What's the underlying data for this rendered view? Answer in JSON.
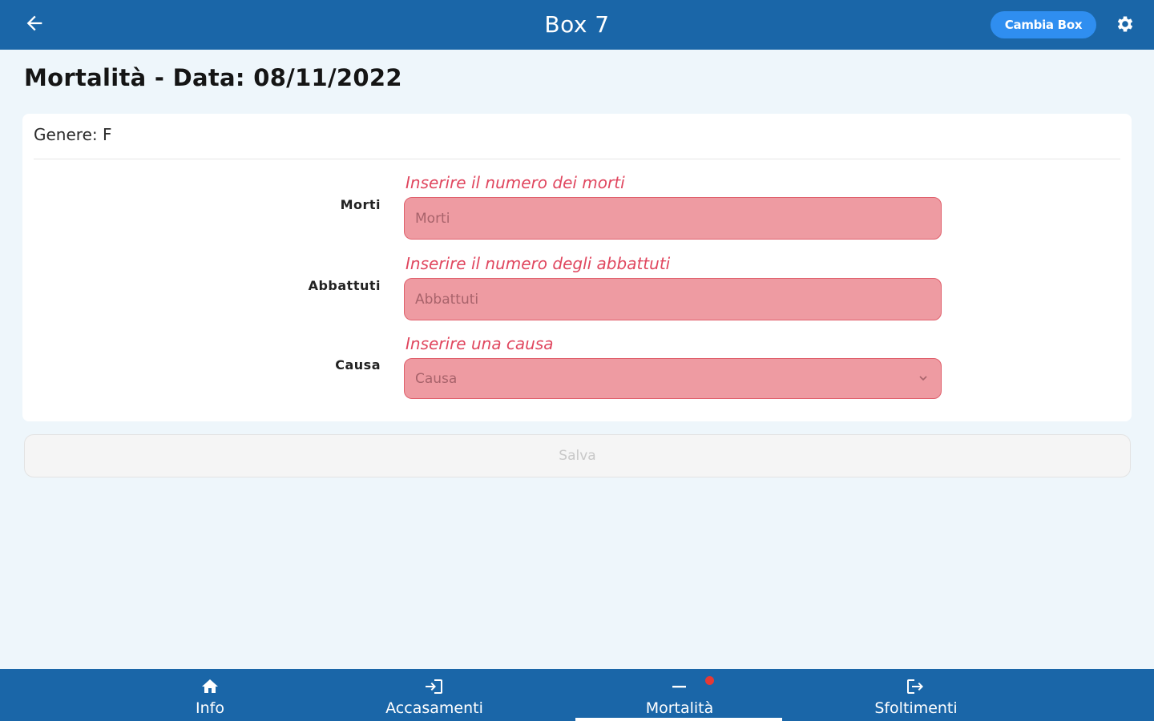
{
  "topbar": {
    "title": "Box 7",
    "cambia_label": "Cambia Box",
    "back_icon": "arrow-left-icon",
    "settings_icon": "gear-icon"
  },
  "page": {
    "heading": "Mortalità - Data: 08/11/2022"
  },
  "card": {
    "genere": "Genere: F",
    "fields": [
      {
        "label": "Morti",
        "hint": "Inserire il numero dei morti",
        "placeholder": "Morti"
      },
      {
        "label": "Abbattuti",
        "hint": "Inserire il numero degli abbattuti",
        "placeholder": "Abbattuti"
      },
      {
        "label": "Causa",
        "hint": "Inserire una causa",
        "placeholder": "Causa"
      }
    ]
  },
  "save_label": "Salva",
  "bottom_nav": {
    "items": [
      {
        "label": "Info",
        "icon": "home-icon"
      },
      {
        "label": "Accasamenti",
        "icon": "login-icon"
      },
      {
        "label": "Mortalità",
        "icon": "minus-icon"
      },
      {
        "label": "Sfoltimenti",
        "icon": "logout-icon"
      }
    ],
    "active": "Mortalità"
  },
  "colors": {
    "primary": "#1a66a8",
    "accent": "#2f8ef0",
    "error": "#e0475f",
    "input_error_bg": "#ee9ba2",
    "badge_dot": "#e53935"
  }
}
